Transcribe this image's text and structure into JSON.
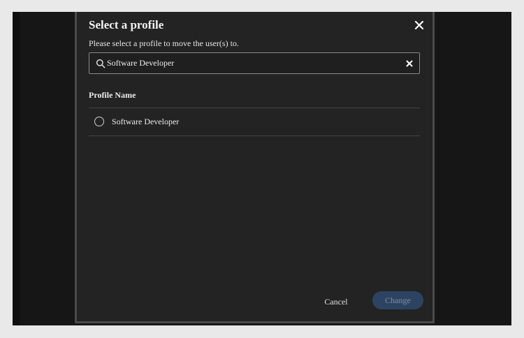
{
  "modal": {
    "title": "Select a profile",
    "subtitle": "Please select a profile to move the user(s) to.",
    "search": {
      "value": "Software Developer",
      "placeholder": ""
    },
    "column_header": "Profile Name",
    "profiles": [
      {
        "label": "Software Developer",
        "selected": false
      }
    ],
    "cancel_label": "Cancel",
    "change_label": "Change",
    "change_enabled": false
  },
  "colors": {
    "modal_bg": "#232323",
    "primary_button_disabled": "#2c4462",
    "text": "#ececec"
  },
  "icons": {
    "close": "close-icon",
    "search": "search-icon",
    "clear": "clear-icon",
    "radio": "radio-unchecked-icon"
  }
}
